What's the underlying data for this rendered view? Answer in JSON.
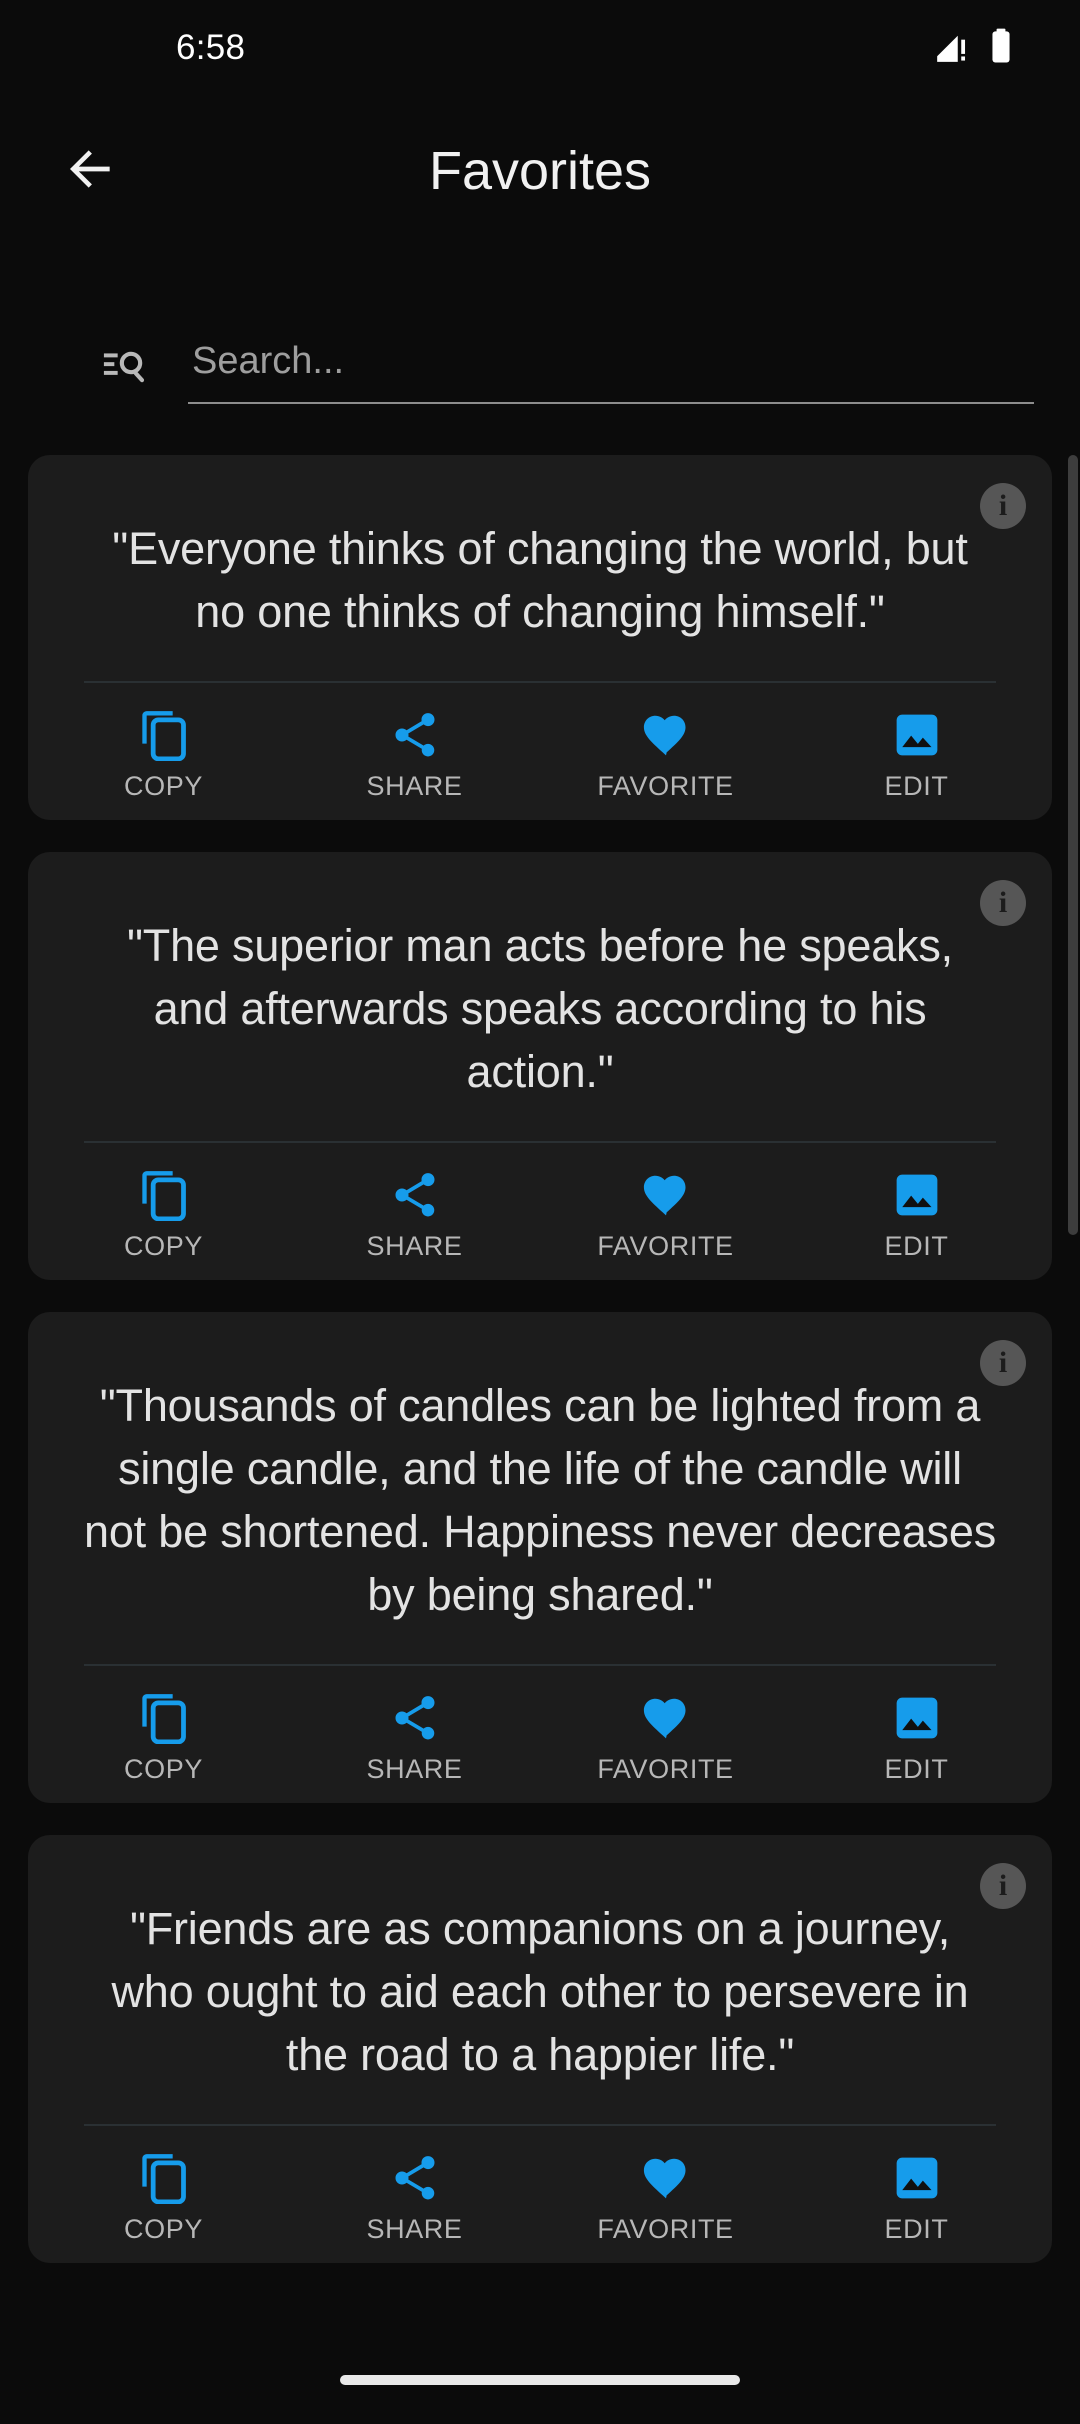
{
  "status_bar": {
    "time": "6:58",
    "signal_icon": "signal-no-service-icon",
    "battery_icon": "battery-full-icon"
  },
  "app_bar": {
    "back_icon": "arrow-back-icon",
    "title": "Favorites"
  },
  "search": {
    "icon": "manage-search-icon",
    "value": "",
    "placeholder": "Search..."
  },
  "colors": {
    "accent": "#169ceb",
    "screen_background": "#0b0b0b",
    "card_background": "#1c1c1c",
    "quote_text": "#e3e3e3",
    "action_label": "#b7b7b7",
    "info_badge": "#565656",
    "scrollbar_thumb": "#3d3d3d"
  },
  "action_labels": {
    "copy": "COPY",
    "share": "SHARE",
    "favorite": "FAVORITE",
    "edit": "EDIT"
  },
  "action_icons": {
    "copy": "copy-icon",
    "share": "share-icon",
    "favorite": "heart-filled-icon",
    "edit": "image-edit-icon"
  },
  "card_info_icon": "info-icon",
  "cards": [
    {
      "quote": "\"Everyone thinks of changing the world, but no one thinks of changing himself.\""
    },
    {
      "quote": "\"The superior man acts before he speaks, and afterwards speaks according to his action.\""
    },
    {
      "quote": "\"Thousands of candles can be lighted from a single candle, and the life of the candle will not be shortened. Happiness never decreases by being shared.\""
    },
    {
      "quote": "\"Friends are as companions on a journey, who ought to aid each other to persevere in the road to a happier life.\""
    }
  ],
  "nav_bar": {
    "home_indicator": "home-gesture-pill"
  }
}
